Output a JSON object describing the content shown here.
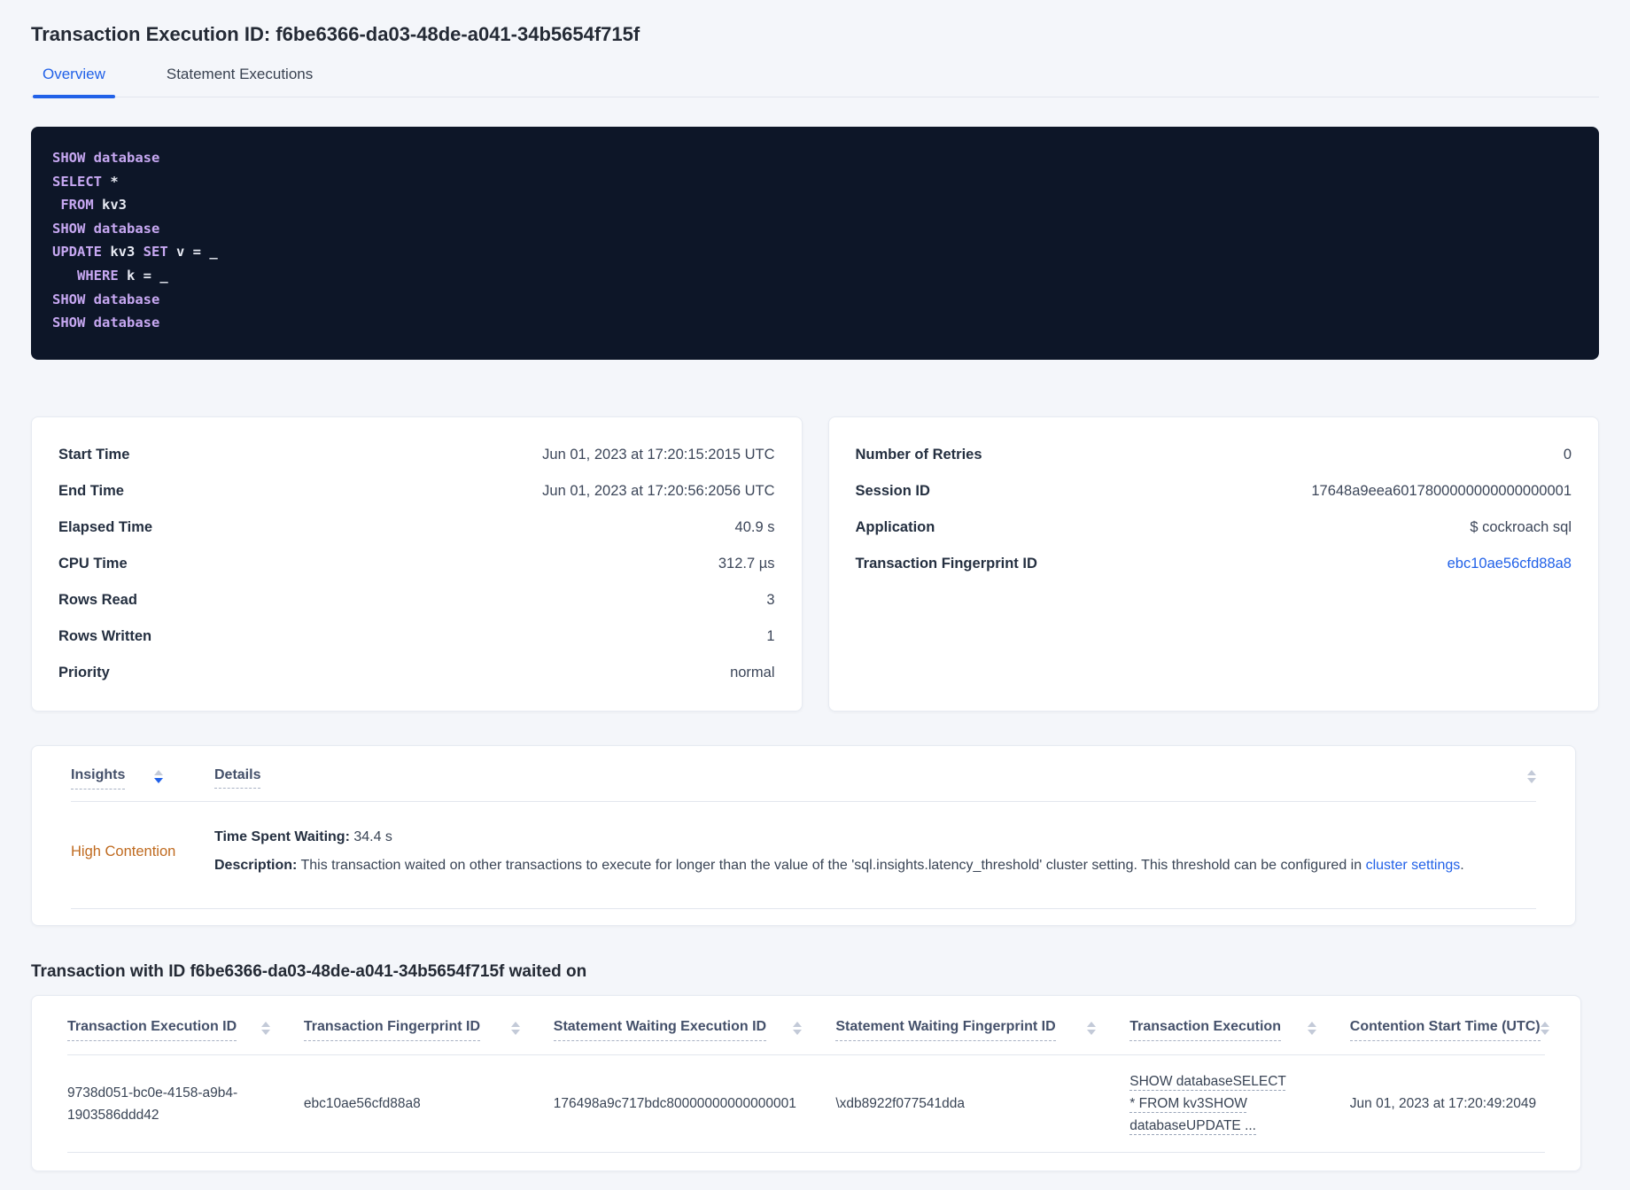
{
  "colors": {
    "accent_blue": "#2161e8",
    "link_blue": "#2161e8",
    "insight_orange": "#bf6a1f",
    "code_background": "#0d1628",
    "code_keyword": "#c7a8f2",
    "code_text": "#e6e9f2"
  },
  "icons": {
    "sort": "sort-arrows-icon"
  },
  "header": {
    "title": "Transaction Execution ID: f6be6366-da03-48de-a041-34b5654f715f",
    "tabs": [
      {
        "label": "Overview",
        "active": true
      },
      {
        "label": "Statement Executions",
        "active": false
      }
    ]
  },
  "sql": {
    "lines": [
      [
        {
          "t": "SHOW database",
          "k": "kw"
        }
      ],
      [
        {
          "t": "SELECT",
          "k": "kw"
        },
        {
          "t": " *",
          "k": "id"
        }
      ],
      [
        {
          "t": " FROM",
          "k": "kw"
        },
        {
          "t": " kv3",
          "k": "id"
        }
      ],
      [
        {
          "t": "SHOW database",
          "k": "kw"
        }
      ],
      [
        {
          "t": "UPDATE",
          "k": "kw"
        },
        {
          "t": " kv3 ",
          "k": "id"
        },
        {
          "t": "SET",
          "k": "kw"
        },
        {
          "t": " v = _",
          "k": "id"
        }
      ],
      [
        {
          "t": "   WHERE",
          "k": "kw"
        },
        {
          "t": " k = _",
          "k": "id"
        }
      ],
      [
        {
          "t": "SHOW database",
          "k": "kw"
        }
      ],
      [
        {
          "t": "SHOW database",
          "k": "kw"
        }
      ]
    ]
  },
  "cards": {
    "left": {
      "rows": [
        {
          "label": "Start Time",
          "value": "Jun 01, 2023 at 17:20:15:2015 UTC"
        },
        {
          "label": "End Time",
          "value": "Jun 01, 2023 at 17:20:56:2056 UTC"
        },
        {
          "label": "Elapsed Time",
          "value": "40.9 s"
        },
        {
          "label": "CPU Time",
          "value": "312.7 µs"
        },
        {
          "label": "Rows Read",
          "value": "3"
        },
        {
          "label": "Rows Written",
          "value": "1"
        },
        {
          "label": "Priority",
          "value": "normal"
        }
      ]
    },
    "right": {
      "rows": [
        {
          "label": "Number of Retries",
          "value": "0"
        },
        {
          "label": "Session ID",
          "value": "17648a9eea6017800000000000000001"
        },
        {
          "label": "Application",
          "value": "$ cockroach sql"
        },
        {
          "label": "Transaction Fingerprint ID",
          "value": "ebc10ae56cfd88a8"
        }
      ]
    }
  },
  "insights": {
    "columns": {
      "insights": "Insights",
      "details": "Details"
    },
    "row": {
      "insight": "High Contention",
      "waiting_label": "Time Spent Waiting:",
      "waiting_value": " 34.4 s",
      "description_label": "Description:",
      "description_text": " This transaction waited on other transactions to execute for longer than the value of the 'sql.insights.latency_threshold' cluster setting. This threshold can be configured in ",
      "description_link": "cluster settings",
      "description_suffix": "."
    }
  },
  "waited_on": {
    "heading": "Transaction with ID f6be6366-da03-48de-a041-34b5654f715f waited on",
    "columns": [
      "Transaction Execution ID",
      "Transaction Fingerprint ID",
      "Statement Waiting Execution ID",
      "Statement Waiting Fingerprint ID",
      "Transaction Execution",
      "Contention Start Time (UTC)"
    ],
    "row": {
      "transaction_execution_id": "9738d051-bc0e-4158-a9b4-1903586ddd42",
      "transaction_fingerprint_id": "ebc10ae56cfd88a8",
      "statement_waiting_execution_id": "176498a9c717bdc80000000000000001",
      "statement_waiting_fingerprint_id": "\\xdb8922f077541dda",
      "transaction_execution": "SHOW databaseSELECT * FROM kv3SHOW databaseUPDATE ...",
      "contention_start_time": "Jun 01, 2023 at 17:20:49:2049"
    }
  }
}
